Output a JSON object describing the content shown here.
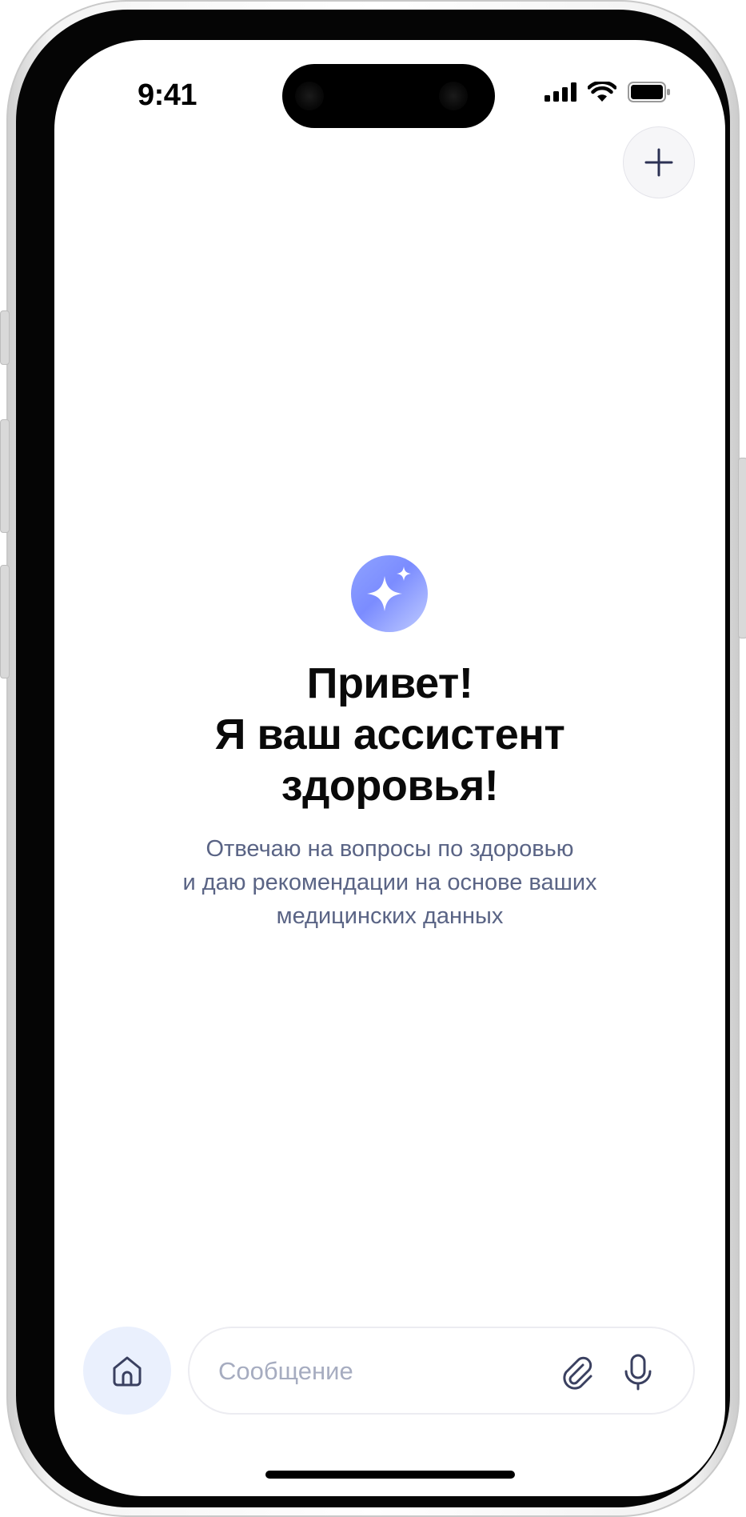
{
  "status_bar": {
    "time": "9:41"
  },
  "header": {
    "new_chat_icon": "plus-icon"
  },
  "hero": {
    "icon": "sparkle-icon",
    "title_lines": [
      "Привет!",
      "Я ваш ассистент",
      "здоровья!"
    ],
    "subtitle_lines": [
      "Отвечаю на вопросы по здоровью",
      "и даю рекомендации на основе ваших",
      "медицинских данных"
    ]
  },
  "bottom_bar": {
    "home_icon": "home-icon",
    "message_placeholder": "Сообщение",
    "attach_icon": "paperclip-icon",
    "mic_icon": "microphone-icon"
  },
  "colors": {
    "accent_gradient_start": "#8fa3ff",
    "accent_gradient_end": "#c0ccff",
    "subtitle": "#5a6485",
    "placeholder": "#a6acc0",
    "home_button_bg": "#eaf0fd"
  }
}
